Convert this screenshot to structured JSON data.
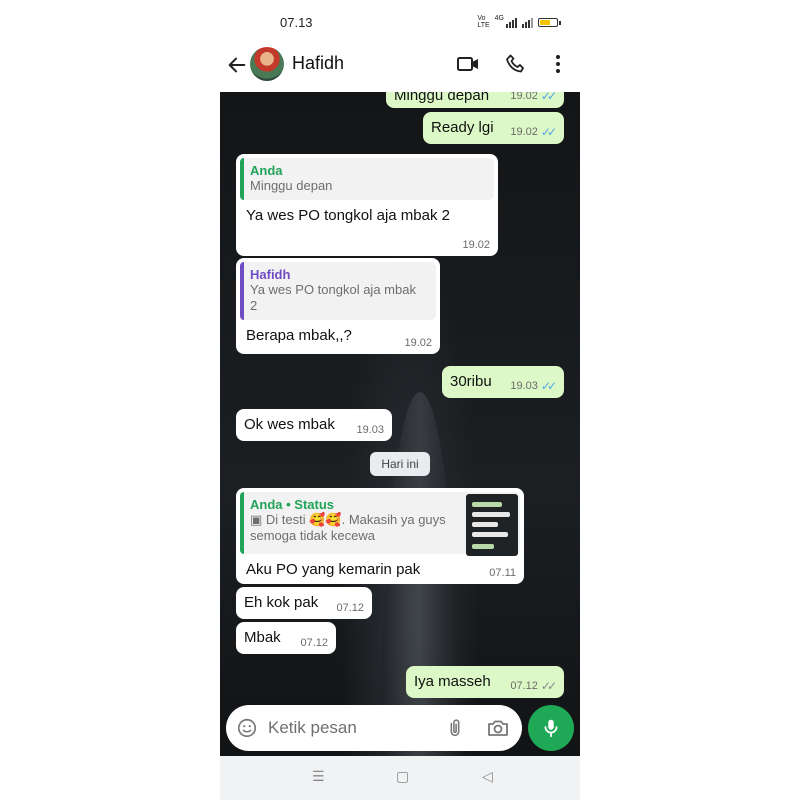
{
  "status_bar": {
    "time": "07.13",
    "network": "4G"
  },
  "header": {
    "contact_name": "Hafidh"
  },
  "messages": [
    {
      "id": "m1",
      "direction": "out",
      "text": "Minggu depan",
      "time": "19.02",
      "read": true
    },
    {
      "id": "m2",
      "direction": "out",
      "text": "Ready lgi",
      "time": "19.02",
      "read": true
    },
    {
      "id": "m3",
      "direction": "in",
      "quote_author": "Anda",
      "quote_text": "Minggu depan",
      "text": "Ya wes PO tongkol aja mbak 2",
      "time": "19.02"
    },
    {
      "id": "m4",
      "direction": "in",
      "quote_author": "Hafidh",
      "quote_text": "Ya wes PO tongkol aja mbak 2",
      "text": "Berapa mbak,,?",
      "time": "19.02"
    },
    {
      "id": "m5",
      "direction": "out",
      "text": "30ribu",
      "time": "19.03",
      "read": true
    },
    {
      "id": "m6",
      "direction": "in",
      "text": "Ok wes mbak",
      "time": "19.03"
    },
    {
      "id": "m7",
      "direction": "in",
      "quote_author": "Anda • Status",
      "quote_text": "Di testi 🥰🥰. Makasih ya guys semoga tidak kecewa",
      "text": "Aku PO yang kemarin pak",
      "time": "07.11"
    },
    {
      "id": "m8",
      "direction": "in",
      "text": "Eh kok pak",
      "time": "07.12"
    },
    {
      "id": "m9",
      "direction": "in",
      "text": "Mbak",
      "time": "07.12"
    },
    {
      "id": "m10",
      "direction": "out",
      "text": "Iya masseh",
      "time": "07.12",
      "read": false
    }
  ],
  "day_divider": "Hari ini",
  "composer": {
    "placeholder": "Ketik pesan"
  },
  "icons": [
    "back-arrow-icon",
    "video-call-icon",
    "voice-call-icon",
    "more-options-icon",
    "emoji-icon",
    "attach-icon",
    "camera-icon",
    "mic-icon",
    "image-icon"
  ],
  "colors": {
    "outgoing_bubble": "#dcf8c6",
    "incoming_bubble": "#ffffff",
    "accent_green": "#1fa855",
    "read_ticks": "#53a6e6",
    "quote_author_self": "#22a35a",
    "quote_author_other": "#6f4ec4"
  }
}
